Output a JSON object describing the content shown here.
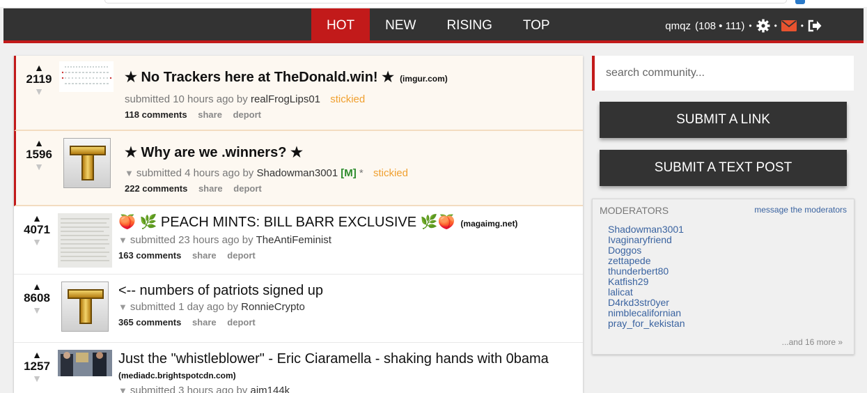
{
  "nav": {
    "tabs": [
      {
        "label": "HOT",
        "active": true
      },
      {
        "label": "NEW",
        "active": false
      },
      {
        "label": "RISING",
        "active": false
      },
      {
        "label": "TOP",
        "active": false
      }
    ]
  },
  "user": {
    "name": "qmqz",
    "karma": "(108 • 111)",
    "separator": "•"
  },
  "posts": [
    {
      "score": "2119",
      "title": "★ No Trackers here at TheDonald.win! ★",
      "domain": "(imgur.com)",
      "submitted": "submitted 10 hours ago by",
      "author": "realFrogLips01",
      "mod_tag": "",
      "asterisk": "",
      "stickied_label": "stickied",
      "comments": "118 comments",
      "share": "share",
      "deport": "deport"
    },
    {
      "score": "1596",
      "title": "★ Why are we .winners? ★",
      "domain": "",
      "submitted": "submitted 4 hours ago by",
      "author": "Shadowman3001",
      "mod_tag": "[M]",
      "asterisk": "*",
      "stickied_label": "stickied",
      "comments": "222 comments",
      "share": "share",
      "deport": "deport"
    },
    {
      "score": "4071",
      "title": "🍑 🌿 PEACH MINTS: BILL BARR EXCLUSIVE 🌿🍑",
      "domain": "(magaimg.net)",
      "submitted": "submitted 23 hours ago by",
      "author": "TheAntiFeminist",
      "mod_tag": "",
      "asterisk": "",
      "stickied_label": "",
      "comments": "163 comments",
      "share": "share",
      "deport": "deport"
    },
    {
      "score": "8608",
      "title": "<-- numbers of patriots signed up",
      "domain": "",
      "submitted": "submitted 1 day ago by",
      "author": "RonnieCrypto",
      "mod_tag": "",
      "asterisk": "",
      "stickied_label": "",
      "comments": "365 comments",
      "share": "share",
      "deport": "deport"
    },
    {
      "score": "1257",
      "title": "Just the \"whistleblower\" - Eric Ciaramella - shaking hands with 0bama",
      "domain": "(mediadc.brightspotcdn.com)",
      "submitted": "submitted 3 hours ago by",
      "author": "aim144k",
      "mod_tag": "",
      "asterisk": "",
      "stickied_label": "",
      "comments": "",
      "share": "",
      "deport": ""
    }
  ],
  "sidebar": {
    "search_placeholder": "search community...",
    "submit_link": "SUBMIT A LINK",
    "submit_text": "SUBMIT A TEXT POST",
    "moderators_header": "MODERATORS",
    "message_moderators": "message the moderators",
    "moderators": [
      "Shadowman3001",
      "Ivaginaryfriend",
      "Doggos",
      "zettapede",
      "thunderbert80",
      "Katfish29",
      "lalicat",
      "D4rkd3str0yer",
      "nimblecalifornian",
      "pray_for_kekistan"
    ],
    "more": "...and 16 more »"
  },
  "colors": {
    "accent": "#c21a1a",
    "header": "#333333",
    "link": "#3a63a0",
    "stickied": "#f0a030",
    "mod": "#2a8a2a"
  },
  "icons": [
    "gear-icon",
    "mail-icon",
    "logout-icon"
  ]
}
